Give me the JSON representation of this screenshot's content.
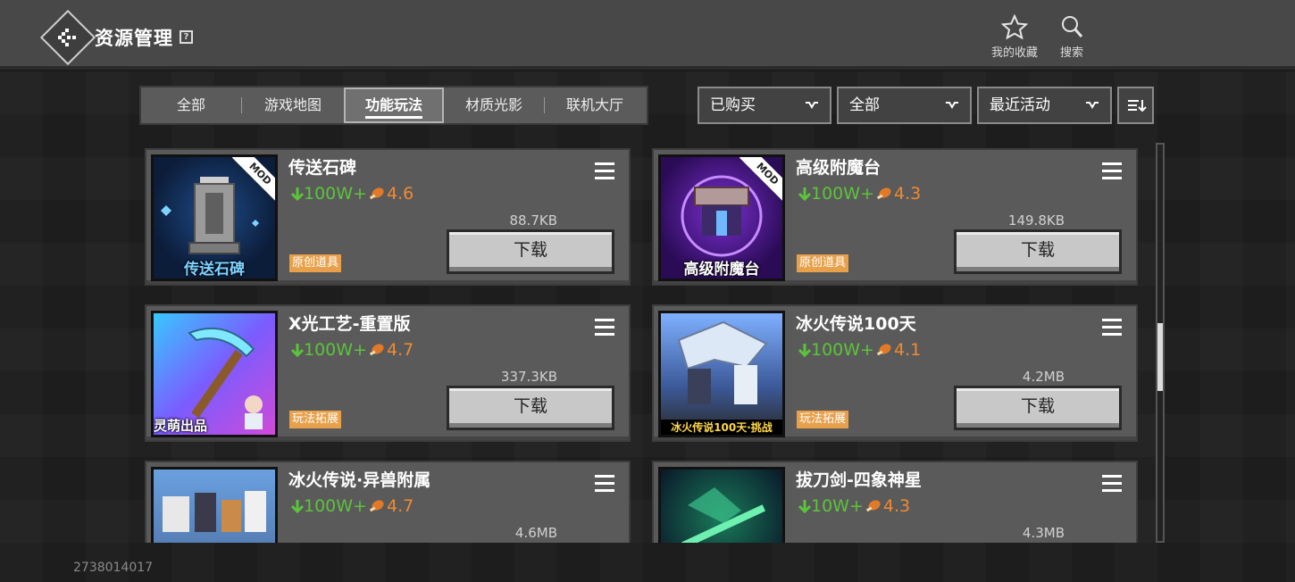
{
  "header": {
    "title": "资源管理",
    "help": "?",
    "favorites_label": "我的收藏",
    "search_label": "搜索"
  },
  "tabs": [
    "全部",
    "游戏地图",
    "功能玩法",
    "材质光影",
    "联机大厅"
  ],
  "active_tab": "功能玩法",
  "filters": {
    "purchase": "已购买",
    "category": "全部",
    "sort": "最近活动"
  },
  "items": [
    {
      "title": "传送石碑",
      "downloads": "100W+",
      "rating": "4.6",
      "size": "88.7KB",
      "tag": "原创道具",
      "button": "下载",
      "mod": "MOD",
      "thumb_caption": "传送石碑"
    },
    {
      "title": "高级附魔台",
      "downloads": "100W+",
      "rating": "4.3",
      "size": "149.8KB",
      "tag": "原创道具",
      "button": "下载",
      "mod": "MOD",
      "thumb_caption": "高级附魔台"
    },
    {
      "title": "X光工艺-重置版",
      "downloads": "100W+",
      "rating": "4.7",
      "size": "337.3KB",
      "tag": "玩法拓展",
      "button": "下载",
      "thumb_caption": "灵萌出品"
    },
    {
      "title": "冰火传说100天",
      "downloads": "100W+",
      "rating": "4.1",
      "size": "4.2MB",
      "tag": "玩法拓展",
      "button": "下载",
      "thumb_caption": "冰火传说100天·挑战"
    },
    {
      "title": "冰火传说·异兽附属",
      "downloads": "100W+",
      "rating": "4.7",
      "size": "4.6MB"
    },
    {
      "title": "拔刀剑-四象神星",
      "downloads": "10W+",
      "rating": "4.3",
      "size": "4.3MB"
    }
  ],
  "footer_id": "2738014017",
  "colors": {
    "download_count": "#5bc43a",
    "rating": "#f08a30",
    "tag_bg": "#e8a04a"
  }
}
